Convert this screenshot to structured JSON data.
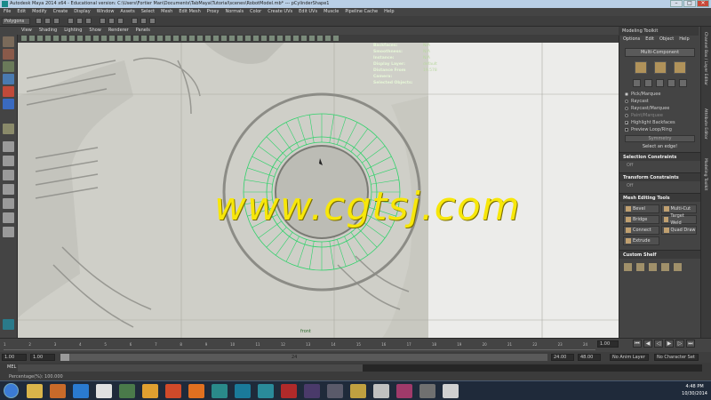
{
  "window": {
    "title": "Autodesk Maya 2014 x64 - Educational version: C:\\Users\\Fortier Man\\Documents\\TabMaya\\Tutorial\\scenes\\RobotModel.mb* --- pCylinderShape1",
    "buttons": [
      "–",
      "□",
      "✕"
    ]
  },
  "menubar": [
    "File",
    "Edit",
    "Modify",
    "Create",
    "Display",
    "Window",
    "Assets",
    "Select",
    "Mesh",
    "Edit Mesh",
    "Proxy",
    "Normals",
    "Color",
    "Create UVs",
    "Edit UVs",
    "Muscle",
    "Pipeline Cache",
    "Help"
  ],
  "status": {
    "mode": "Polygons"
  },
  "viewport": {
    "menu": [
      "View",
      "Shading",
      "Lighting",
      "Show",
      "Renderer",
      "Panels"
    ],
    "camera_label": "front",
    "hud": [
      {
        "label": "Backfaces:",
        "value": "N/A"
      },
      {
        "label": "Smoothness:",
        "value": "N/A"
      },
      {
        "label": "Instance:",
        "value": "N/A"
      },
      {
        "label": "Display Layer:",
        "value": "default"
      },
      {
        "label": "Distance From Camera:",
        "value": "19.578"
      },
      {
        "label": "Selected Objects:",
        "value": ""
      }
    ]
  },
  "watermark": "www.cgtsj.com",
  "toolkit": {
    "tab": "Modeling Toolkit",
    "menu": [
      "Options",
      "Edit",
      "Object",
      "Help"
    ],
    "multi_component": "Multi-Component",
    "options": [
      {
        "label": "Pick/Marquee",
        "kind": "radio",
        "on": true,
        "dim": false
      },
      {
        "label": "Raycast",
        "kind": "radio",
        "on": false,
        "dim": false
      },
      {
        "label": "Raycast/Marquee",
        "kind": "radio",
        "on": false,
        "dim": false
      },
      {
        "label": "Paint/Marquee",
        "kind": "radio",
        "on": false,
        "dim": true
      },
      {
        "label": "Highlight Backfaces",
        "kind": "check",
        "on": true,
        "dim": false
      },
      {
        "label": "Preview Loop/Ring",
        "kind": "check",
        "on": false,
        "dim": false
      }
    ],
    "symmetry": "Symmetry",
    "hint": "Select an edge!",
    "selection_constraints": "Selection Constraints",
    "transform_constraints": "Transform Constraints",
    "off": "Off",
    "mesh_editing_tools": "Mesh Editing Tools",
    "tools": [
      "Bevel",
      "Multi-Cut",
      "Bridge",
      "Target Weld",
      "Connect",
      "Quad Draw",
      "Extrude"
    ],
    "custom_shelf": "Custom Shelf"
  },
  "side_tabs": [
    "Channel Box / Layer Editor",
    "Attribute Editor",
    "Modeling Toolkit"
  ],
  "timeline": {
    "ticks": [
      "1",
      "2",
      "3",
      "4",
      "5",
      "6",
      "7",
      "8",
      "9",
      "10",
      "11",
      "12",
      "13",
      "14",
      "15",
      "16",
      "17",
      "18",
      "19",
      "20",
      "21",
      "22",
      "23",
      "24"
    ],
    "current_frame": "1.00",
    "start": "1.00",
    "playback_start": "1.00",
    "slider_label": "24",
    "playback_end": "24.00",
    "end": "48.00",
    "anim_layer": "No Anim Layer",
    "char_set": "No Character Set"
  },
  "cmdline": {
    "label": "MEL"
  },
  "helpline": "Percentage(%): 100.000",
  "taskbar": {
    "time": "4:48 PM",
    "date": "10/30/2014"
  }
}
